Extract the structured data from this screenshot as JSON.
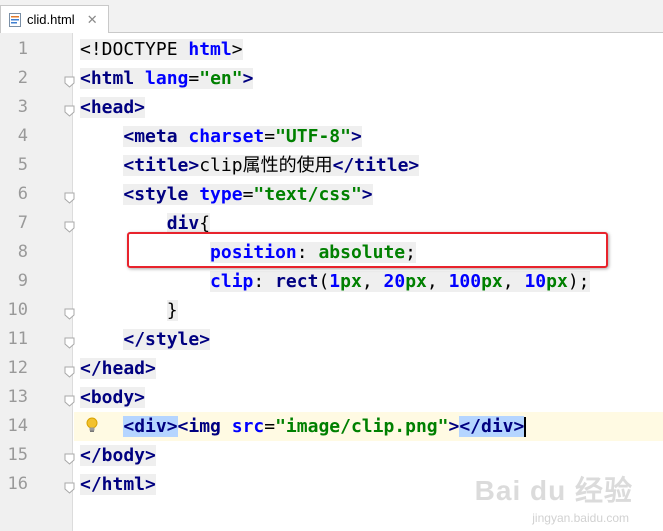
{
  "tab": {
    "filename": "clid.html",
    "close_glyph": "✕",
    "icon": "html-file-icon"
  },
  "editor": {
    "line_numbers": [
      "1",
      "2",
      "3",
      "4",
      "5",
      "6",
      "7",
      "8",
      "9",
      "10",
      "11",
      "12",
      "13",
      "14",
      "15",
      "16"
    ],
    "current_line": 14,
    "lines": [
      {
        "indent": "",
        "tokens": [
          {
            "t": "doctype",
            "v": "<!DOCTYPE "
          },
          {
            "t": "attr",
            "v": "html"
          },
          {
            "t": "doctype",
            "v": ">"
          }
        ]
      },
      {
        "indent": "",
        "tokens": [
          {
            "t": "tag",
            "v": "<html "
          },
          {
            "t": "attr",
            "v": "lang"
          },
          {
            "t": "text",
            "v": "="
          },
          {
            "t": "val",
            "v": "\"en\""
          },
          {
            "t": "tag",
            "v": ">"
          }
        ]
      },
      {
        "indent": "",
        "tokens": [
          {
            "t": "tag",
            "v": "<head>"
          }
        ]
      },
      {
        "indent": "    ",
        "tokens": [
          {
            "t": "tag",
            "v": "<meta "
          },
          {
            "t": "attr",
            "v": "charset"
          },
          {
            "t": "text",
            "v": "="
          },
          {
            "t": "val",
            "v": "\"UTF-8\""
          },
          {
            "t": "tag",
            "v": ">"
          }
        ]
      },
      {
        "indent": "    ",
        "tokens": [
          {
            "t": "tag",
            "v": "<title>"
          },
          {
            "t": "text",
            "v": "clip属性的使用"
          },
          {
            "t": "tag",
            "v": "</title>"
          }
        ]
      },
      {
        "indent": "    ",
        "tokens": [
          {
            "t": "tag",
            "v": "<style "
          },
          {
            "t": "attr",
            "v": "type"
          },
          {
            "t": "text",
            "v": "="
          },
          {
            "t": "val",
            "v": "\"text/css\""
          },
          {
            "t": "tag",
            "v": ">"
          }
        ]
      },
      {
        "indent": "        ",
        "tokens": [
          {
            "t": "tag",
            "v": "div"
          },
          {
            "t": "text",
            "v": "{"
          }
        ]
      },
      {
        "indent": "            ",
        "tokens": [
          {
            "t": "prop",
            "v": "position"
          },
          {
            "t": "text",
            "v": ": "
          },
          {
            "t": "val",
            "v": "absolute"
          },
          {
            "t": "text",
            "v": ";"
          }
        ]
      },
      {
        "indent": "            ",
        "tokens": [
          {
            "t": "prop",
            "v": "clip"
          },
          {
            "t": "text",
            "v": ": "
          },
          {
            "t": "tag",
            "v": "rect"
          },
          {
            "t": "text",
            "v": "("
          },
          {
            "t": "num",
            "v": "1"
          },
          {
            "t": "val",
            "v": "px"
          },
          {
            "t": "text",
            "v": ", "
          },
          {
            "t": "num",
            "v": "20"
          },
          {
            "t": "val",
            "v": "px"
          },
          {
            "t": "text",
            "v": ", "
          },
          {
            "t": "num",
            "v": "100"
          },
          {
            "t": "val",
            "v": "px"
          },
          {
            "t": "text",
            "v": ", "
          },
          {
            "t": "num",
            "v": "10"
          },
          {
            "t": "val",
            "v": "px"
          },
          {
            "t": "text",
            "v": ");"
          }
        ]
      },
      {
        "indent": "        ",
        "tokens": [
          {
            "t": "text",
            "v": "}"
          }
        ]
      },
      {
        "indent": "    ",
        "tokens": [
          {
            "t": "tag",
            "v": "</style>"
          }
        ]
      },
      {
        "indent": "",
        "tokens": [
          {
            "t": "tag",
            "v": "</head>"
          }
        ]
      },
      {
        "indent": "",
        "tokens": [
          {
            "t": "tag",
            "v": "<body>"
          }
        ]
      },
      {
        "indent": "    ",
        "tokens": [
          {
            "t": "taghl",
            "v": "<div>"
          },
          {
            "t": "tag",
            "v": "<img "
          },
          {
            "t": "attr",
            "v": "src"
          },
          {
            "t": "text",
            "v": "="
          },
          {
            "t": "val",
            "v": "\"image/clip.png\""
          },
          {
            "t": "tag",
            "v": ">"
          },
          {
            "t": "taghl",
            "v": "</div>"
          }
        ]
      },
      {
        "indent": "",
        "tokens": [
          {
            "t": "tag",
            "v": "</body>"
          }
        ]
      },
      {
        "indent": "",
        "tokens": [
          {
            "t": "tag",
            "v": "</html>"
          }
        ]
      }
    ],
    "fold_markers_on_lines": [
      2,
      3,
      6,
      7,
      10,
      11,
      12,
      13,
      15,
      16
    ],
    "bulb_on_line": 14,
    "highlighted_line": 9
  },
  "watermark": {
    "main": "Bai du 经验",
    "sub": "jingyan.baidu.com"
  },
  "colors": {
    "tag": "#000080",
    "attr": "#0000ff",
    "value": "#008000",
    "highlight_border": "#e8232c",
    "current_line": "#fffae3",
    "tag_match": "#b5d5ff"
  }
}
